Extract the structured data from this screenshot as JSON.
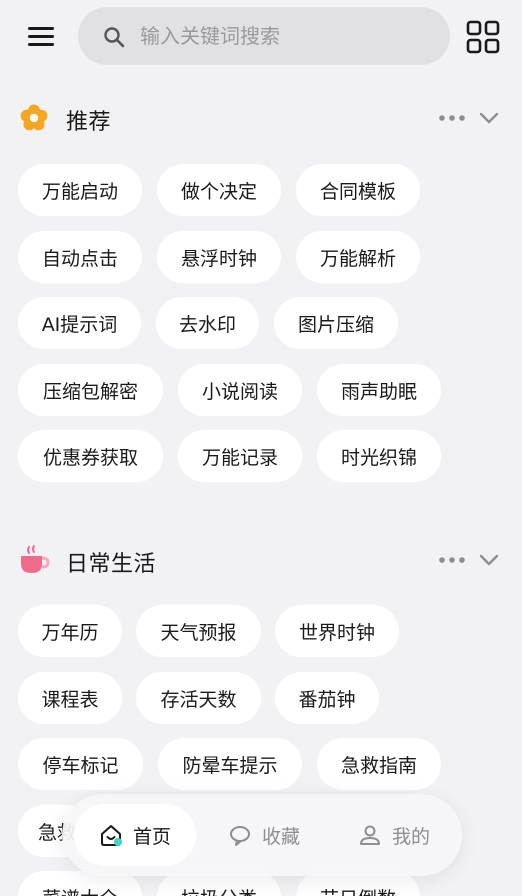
{
  "search": {
    "placeholder": "输入关键词搜索"
  },
  "sections": [
    {
      "title": "推荐",
      "icon": "flower-icon",
      "chips": [
        "万能启动",
        "做个决定",
        "合同模板",
        "自动点击",
        "悬浮时钟",
        "万能解析",
        "AI提示词",
        "去水印",
        "图片压缩",
        "压缩包解密",
        "小说阅读",
        "雨声助眠",
        "优惠券获取",
        "万能记录",
        "时光织锦"
      ]
    },
    {
      "title": "日常生活",
      "icon": "coffee-cup-icon",
      "chips": [
        "万年历",
        "天气预报",
        "世界时钟",
        "课程表",
        "存活天数",
        "番茄钟",
        "停车标记",
        "防晕车提示",
        "急救指南",
        "急救",
        "菜谱大全",
        "垃圾分类",
        "节日倒数"
      ]
    }
  ],
  "bottom_nav": {
    "items": [
      {
        "label": "首页",
        "icon": "home-icon",
        "active": true
      },
      {
        "label": "收藏",
        "icon": "bookmark-icon",
        "active": false
      },
      {
        "label": "我的",
        "icon": "user-icon",
        "active": false
      }
    ]
  },
  "colors": {
    "background": "#f2f2f4",
    "chip": "#ffffff",
    "accent_flower": "#f5a623",
    "accent_cup": "#f06b8a"
  }
}
